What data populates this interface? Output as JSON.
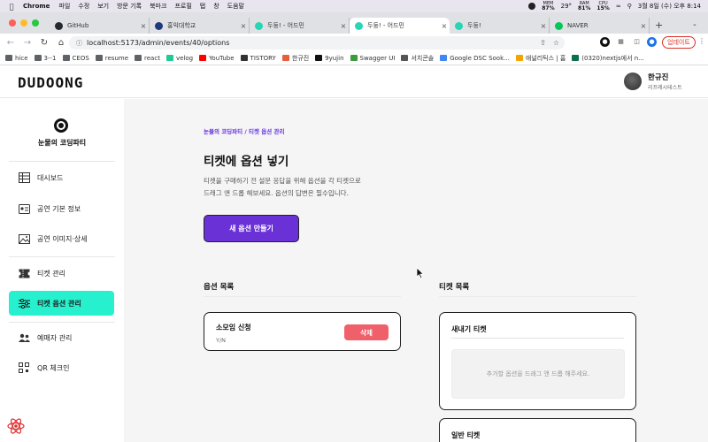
{
  "macbar": {
    "app": "Chrome",
    "menus": [
      "파일",
      "수정",
      "보기",
      "방문 기록",
      "북마크",
      "프로필",
      "탭",
      "창",
      "도움말"
    ],
    "mem_label": "MEM",
    "mem_value": "87%",
    "temp": "29°",
    "ram_label": "RAM",
    "ram_value": "81%",
    "cpu_label": "CPU",
    "cpu_value": "15%",
    "datetime": "3월 8일 (수) 오후 8:14"
  },
  "tabs": [
    {
      "label": "GitHub",
      "color": "#24292f",
      "active": false
    },
    {
      "label": "홍익대학교",
      "color": "#1f3a7a",
      "active": false
    },
    {
      "label": "두둥! - 어드민",
      "color": "#26d6b4",
      "active": false
    },
    {
      "label": "두둥! - 어드민",
      "color": "#26d6b4",
      "active": true
    },
    {
      "label": "두둥!",
      "color": "#26d6b4",
      "active": false
    },
    {
      "label": "NAVER",
      "color": "#03c75a",
      "active": false
    }
  ],
  "address": {
    "url": "localhost:5173/admin/events/40/options",
    "update_label": "업데이트"
  },
  "bookmarks": [
    "hice",
    "3--1",
    "CEOS",
    "resume",
    "react",
    "velog",
    "YouTube",
    "TISTORY",
    "한규진",
    "9yujin",
    "Swagger UI",
    "서치콘솔",
    "Google DSC Sook...",
    "애널리틱스 | 홈",
    "(0320)nextjs에서 n..."
  ],
  "header": {
    "logo": "DUDOONG",
    "user_name": "한규진",
    "user_role": "리프레시테스트"
  },
  "sidebar": {
    "event_name": "눈물의 코딩파티",
    "items": [
      {
        "label": "대시보드",
        "icon": "table-icon"
      },
      {
        "label": "공연 기본 정보",
        "icon": "id-card-icon"
      },
      {
        "label": "공연 이미지·상세",
        "icon": "image-icon"
      },
      {
        "label": "티켓 관리",
        "icon": "ticket-icon"
      },
      {
        "label": "티켓 옵션 관리",
        "icon": "sliders-icon"
      },
      {
        "label": "예매자 관리",
        "icon": "users-icon"
      },
      {
        "label": "QR 체크인",
        "icon": "qr-icon"
      }
    ],
    "active_index": 4
  },
  "main": {
    "breadcrumb": "눈물의 코딩파티 / 티켓 옵션 관리",
    "title": "티켓에 옵션 넣기",
    "description_line1": "티켓을 구매하기 전 설문 응답을 위해 옵션을 각 티켓으로",
    "description_line2": "드래그 앤 드롭 해보세요. 옵션의 답변은 필수입니다.",
    "cta_label": "새 옵션 만들기",
    "options_heading": "옵션 목록",
    "tickets_heading": "티켓 목록",
    "options": [
      {
        "name": "소모임 신청",
        "type": "Y/N",
        "delete_label": "삭제"
      }
    ],
    "tickets": [
      {
        "name": "새내기 티켓",
        "dropzone": "추가할 옵션을 드래그 앤 드롭 해주세요."
      },
      {
        "name": "일반 티켓"
      }
    ]
  },
  "colors": {
    "accent_mint": "#26f0cd",
    "primary_purple": "#6a31d6",
    "delete_red": "#f0606b"
  }
}
